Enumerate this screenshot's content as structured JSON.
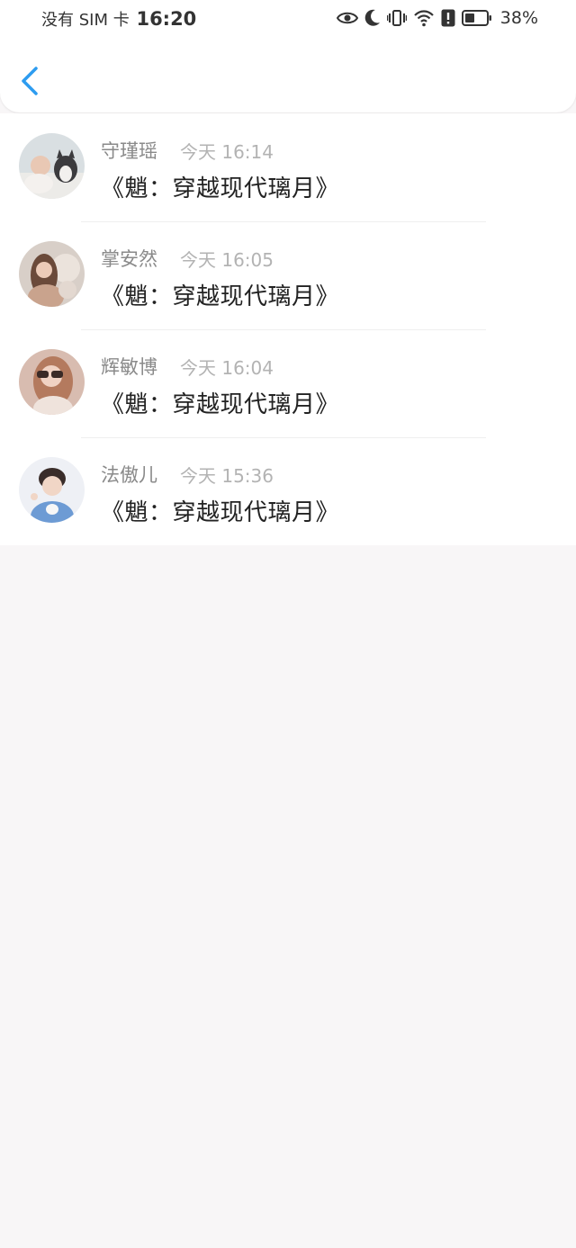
{
  "status_bar": {
    "carrier": "没有 SIM 卡",
    "time": "16:20",
    "battery": "38%",
    "icons": [
      "eye-icon",
      "moon-icon",
      "vibrate-icon",
      "wifi-icon",
      "alert-icon",
      "battery-icon"
    ]
  },
  "header": {
    "back_icon": "chevron-left-icon",
    "accent_color": "#2d9cf0"
  },
  "messages": [
    {
      "name": "守瑾瑶",
      "time": "今天 16:14",
      "content": "《魈：穿越现代璃月》"
    },
    {
      "name": "掌安然",
      "time": "今天 16:05",
      "content": "《魈：穿越现代璃月》"
    },
    {
      "name": "辉敏博",
      "time": "今天 16:04",
      "content": "《魈：穿越现代璃月》"
    },
    {
      "name": "法傲儿",
      "time": "今天 15:36",
      "content": "《魈：穿越现代璃月》"
    }
  ]
}
